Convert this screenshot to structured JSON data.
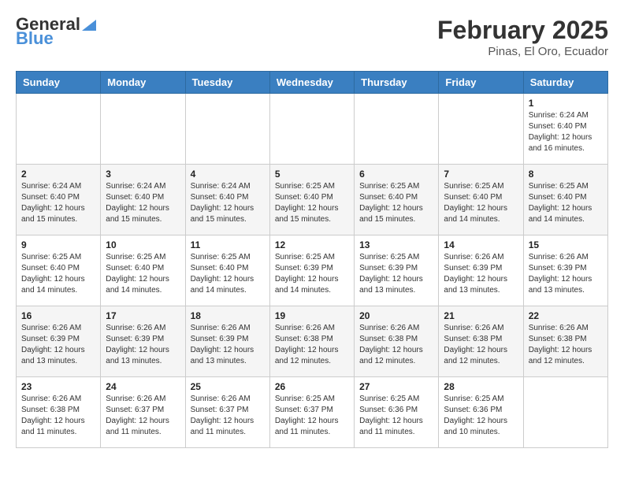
{
  "logo": {
    "text_general": "General",
    "text_blue": "Blue"
  },
  "header": {
    "month_title": "February 2025",
    "subtitle": "Pinas, El Oro, Ecuador"
  },
  "days_of_week": [
    "Sunday",
    "Monday",
    "Tuesday",
    "Wednesday",
    "Thursday",
    "Friday",
    "Saturday"
  ],
  "weeks": [
    [
      {
        "day": "",
        "info": ""
      },
      {
        "day": "",
        "info": ""
      },
      {
        "day": "",
        "info": ""
      },
      {
        "day": "",
        "info": ""
      },
      {
        "day": "",
        "info": ""
      },
      {
        "day": "",
        "info": ""
      },
      {
        "day": "1",
        "info": "Sunrise: 6:24 AM\nSunset: 6:40 PM\nDaylight: 12 hours and 16 minutes."
      }
    ],
    [
      {
        "day": "2",
        "info": "Sunrise: 6:24 AM\nSunset: 6:40 PM\nDaylight: 12 hours and 15 minutes."
      },
      {
        "day": "3",
        "info": "Sunrise: 6:24 AM\nSunset: 6:40 PM\nDaylight: 12 hours and 15 minutes."
      },
      {
        "day": "4",
        "info": "Sunrise: 6:24 AM\nSunset: 6:40 PM\nDaylight: 12 hours and 15 minutes."
      },
      {
        "day": "5",
        "info": "Sunrise: 6:25 AM\nSunset: 6:40 PM\nDaylight: 12 hours and 15 minutes."
      },
      {
        "day": "6",
        "info": "Sunrise: 6:25 AM\nSunset: 6:40 PM\nDaylight: 12 hours and 15 minutes."
      },
      {
        "day": "7",
        "info": "Sunrise: 6:25 AM\nSunset: 6:40 PM\nDaylight: 12 hours and 14 minutes."
      },
      {
        "day": "8",
        "info": "Sunrise: 6:25 AM\nSunset: 6:40 PM\nDaylight: 12 hours and 14 minutes."
      }
    ],
    [
      {
        "day": "9",
        "info": "Sunrise: 6:25 AM\nSunset: 6:40 PM\nDaylight: 12 hours and 14 minutes."
      },
      {
        "day": "10",
        "info": "Sunrise: 6:25 AM\nSunset: 6:40 PM\nDaylight: 12 hours and 14 minutes."
      },
      {
        "day": "11",
        "info": "Sunrise: 6:25 AM\nSunset: 6:40 PM\nDaylight: 12 hours and 14 minutes."
      },
      {
        "day": "12",
        "info": "Sunrise: 6:25 AM\nSunset: 6:39 PM\nDaylight: 12 hours and 14 minutes."
      },
      {
        "day": "13",
        "info": "Sunrise: 6:25 AM\nSunset: 6:39 PM\nDaylight: 12 hours and 13 minutes."
      },
      {
        "day": "14",
        "info": "Sunrise: 6:26 AM\nSunset: 6:39 PM\nDaylight: 12 hours and 13 minutes."
      },
      {
        "day": "15",
        "info": "Sunrise: 6:26 AM\nSunset: 6:39 PM\nDaylight: 12 hours and 13 minutes."
      }
    ],
    [
      {
        "day": "16",
        "info": "Sunrise: 6:26 AM\nSunset: 6:39 PM\nDaylight: 12 hours and 13 minutes."
      },
      {
        "day": "17",
        "info": "Sunrise: 6:26 AM\nSunset: 6:39 PM\nDaylight: 12 hours and 13 minutes."
      },
      {
        "day": "18",
        "info": "Sunrise: 6:26 AM\nSunset: 6:39 PM\nDaylight: 12 hours and 13 minutes."
      },
      {
        "day": "19",
        "info": "Sunrise: 6:26 AM\nSunset: 6:38 PM\nDaylight: 12 hours and 12 minutes."
      },
      {
        "day": "20",
        "info": "Sunrise: 6:26 AM\nSunset: 6:38 PM\nDaylight: 12 hours and 12 minutes."
      },
      {
        "day": "21",
        "info": "Sunrise: 6:26 AM\nSunset: 6:38 PM\nDaylight: 12 hours and 12 minutes."
      },
      {
        "day": "22",
        "info": "Sunrise: 6:26 AM\nSunset: 6:38 PM\nDaylight: 12 hours and 12 minutes."
      }
    ],
    [
      {
        "day": "23",
        "info": "Sunrise: 6:26 AM\nSunset: 6:38 PM\nDaylight: 12 hours and 11 minutes."
      },
      {
        "day": "24",
        "info": "Sunrise: 6:26 AM\nSunset: 6:37 PM\nDaylight: 12 hours and 11 minutes."
      },
      {
        "day": "25",
        "info": "Sunrise: 6:26 AM\nSunset: 6:37 PM\nDaylight: 12 hours and 11 minutes."
      },
      {
        "day": "26",
        "info": "Sunrise: 6:25 AM\nSunset: 6:37 PM\nDaylight: 12 hours and 11 minutes."
      },
      {
        "day": "27",
        "info": "Sunrise: 6:25 AM\nSunset: 6:36 PM\nDaylight: 12 hours and 11 minutes."
      },
      {
        "day": "28",
        "info": "Sunrise: 6:25 AM\nSunset: 6:36 PM\nDaylight: 12 hours and 10 minutes."
      },
      {
        "day": "",
        "info": ""
      }
    ]
  ]
}
